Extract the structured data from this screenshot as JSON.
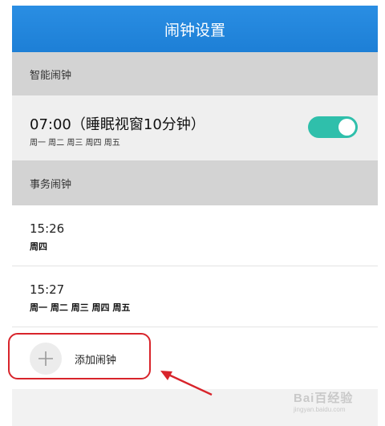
{
  "header": {
    "title": "闹钟设置"
  },
  "smart_section": {
    "label": "智能闹钟",
    "alarm": {
      "title": "07:00（睡眠视窗10分钟）",
      "days": "周一 周二 周三 周四 周五",
      "enabled": true
    }
  },
  "task_section": {
    "label": "事务闹钟",
    "alarms": [
      {
        "time": "15:26",
        "days": "周四"
      },
      {
        "time": "15:27",
        "days": "周一 周二 周三 周四 周五"
      }
    ]
  },
  "add_alarm": {
    "label": "添加闹钟",
    "icon": "plus-icon"
  },
  "annotation": {
    "highlight_color": "#d8242b"
  },
  "colors": {
    "header": "#1d7fd6",
    "toggle_on": "#2fbfab",
    "section_bg": "#d3d3d3"
  },
  "watermark": {
    "brand": "Bai百经验",
    "url": "jingyan.baidu.com"
  }
}
